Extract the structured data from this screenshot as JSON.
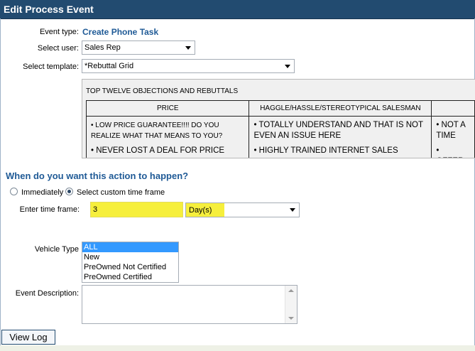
{
  "dialog": {
    "title": "Edit Process Event"
  },
  "event_type": {
    "label": "Event type:",
    "value": "Create Phone Task"
  },
  "select_user": {
    "label": "Select user:",
    "value": "Sales Rep"
  },
  "select_template": {
    "label": "Select template:",
    "value": "*Rebuttal Grid"
  },
  "template_preview": {
    "heading": "TOP TWELVE OBJECTIONS AND REBUTTALS",
    "columns": [
      {
        "header": "PRICE",
        "items": [
          "• LOW PRICE GUARANTEE!!!! DO YOU REALIZE WHAT THAT MEANS TO YOU?",
          "• NEVER LOST A DEAL FOR PRICE"
        ]
      },
      {
        "header": "HAGGLE/HASSLE/STEREOTYPICAL SALESMAN",
        "items": [
          "• TOTALLY UNDERSTAND AND THAT IS NOT EVEN AN ISSUE HERE",
          "• HIGHLY TRAINED INTERNET SALES"
        ]
      },
      {
        "header": "",
        "items": [
          "• NOT A TIME",
          "• OFFER"
        ]
      }
    ]
  },
  "timing": {
    "section_title": "When do you want this action to happen?",
    "options": [
      {
        "label": "Immediately",
        "checked": false
      },
      {
        "label": "Select custom time frame",
        "checked": true
      }
    ],
    "time_frame_label": "Enter time frame:",
    "time_frame_value": "3",
    "time_unit": "Day(s)",
    "highlight_color": "#f6ef3c"
  },
  "vehicle_type": {
    "label": "Vehicle Type",
    "options": [
      {
        "label": "ALL",
        "selected": true
      },
      {
        "label": "New",
        "selected": false
      },
      {
        "label": "PreOwned Not Certified",
        "selected": false
      },
      {
        "label": "PreOwned Certified",
        "selected": false
      }
    ]
  },
  "event_description": {
    "label": "Event Description:",
    "value": ""
  },
  "buttons": {
    "view_log": "View Log"
  },
  "colors": {
    "title_bar": "#224b70",
    "accent_text": "#1f5a96",
    "selection": "#3399ff"
  }
}
